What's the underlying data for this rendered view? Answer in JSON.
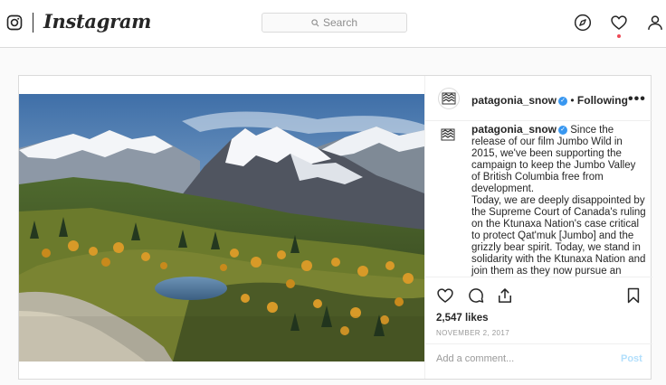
{
  "header": {
    "brand_wordmark": "Instagram",
    "search_placeholder": "Search",
    "icons": [
      "instagram-glyph-icon",
      "explore-compass-icon",
      "activity-heart-icon",
      "profile-icon"
    ],
    "activity_dot_color": "#ed4956"
  },
  "post": {
    "author": {
      "username": "patagonia_snow",
      "verified": true,
      "separator": "•",
      "follow_status": "Following"
    },
    "more_options_label": "•••",
    "photo": {
      "subject": "alpine mountains, larch trees and a small lake"
    },
    "caption": {
      "username": "patagonia_snow",
      "text": "Since the release of our film Jumbo Wild in 2015, we've been supporting the campaign to keep the Jumbo Valley of British Columbia free from development.",
      "text2": "Today, we are deeply disappointed by the Supreme Court of Canada's ruling on the Ktunaxa Nation's case critical to protect Qat'muk [Jumbo] and the grizzly bear spirit. Today, we stand in solidarity with the Ktunaxa Nation and join them as they now pursue an indigenous protected area."
    },
    "actions": [
      "like-icon",
      "comment-icon",
      "share-icon",
      "save-bookmark-icon"
    ],
    "likes": "2,547 likes",
    "date": "NOVEMBER 2, 2017",
    "comment_placeholder": "Add a comment...",
    "post_button": "Post"
  },
  "colors": {
    "verified_badge": "#3897f0",
    "post_button_disabled": "#b2dffc",
    "border": "#dbdbdb"
  }
}
